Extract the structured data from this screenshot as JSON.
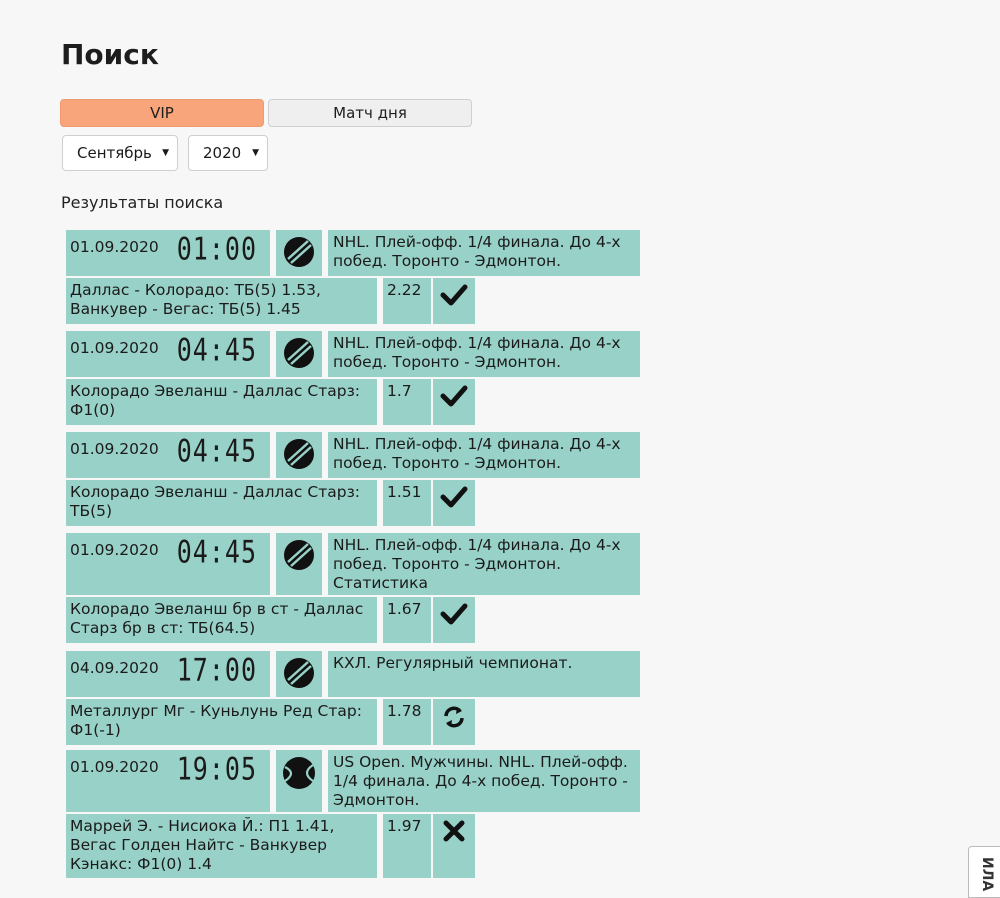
{
  "page": {
    "title": "Поиск"
  },
  "tabs": [
    {
      "label": "VIP",
      "active": true
    },
    {
      "label": "Матч дня",
      "active": false
    }
  ],
  "filters": {
    "month": "Сентябрь",
    "year": "2020"
  },
  "results_title": "Результаты поиска",
  "colors": {
    "row_bg": "#98d1c8",
    "active_tab": "#f8a57c",
    "page_bg": "#f7f7f7"
  },
  "results": [
    {
      "date": "01.09.2020",
      "time": "01:00",
      "sport_icon": "hockey-puck-icon",
      "description": "NHL. Плей-офф. 1/4 финала. До 4-х побед. Торонто - Эдмонтон.",
      "bet": "Даллас - Колорадо: ТБ(5) 1.53, Ванкувер - Вегас: ТБ(5) 1.45",
      "coef": "2.22",
      "status": "win",
      "status_glyph": "✔"
    },
    {
      "date": "01.09.2020",
      "time": "04:45",
      "sport_icon": "hockey-puck-icon",
      "description": "NHL. Плей-офф. 1/4 финала. До 4-х побед. Торонто - Эдмонтон.",
      "bet": "Колорадо Эвеланш - Даллас Старз: Ф1(0)",
      "coef": "1.7",
      "status": "win",
      "status_glyph": "✔"
    },
    {
      "date": "01.09.2020",
      "time": "04:45",
      "sport_icon": "hockey-puck-icon",
      "description": "NHL. Плей-офф. 1/4 финала. До 4-х побед. Торонто - Эдмонтон.",
      "bet": "Колорадо Эвеланш - Даллас Старз: ТБ(5)",
      "coef": "1.51",
      "status": "win",
      "status_glyph": "✔"
    },
    {
      "date": "01.09.2020",
      "time": "04:45",
      "sport_icon": "hockey-puck-icon",
      "description": "NHL. Плей-офф. 1/4 финала. До 4-х побед. Торонто - Эдмонтон. Статистика",
      "bet": "Колорадо Эвеланш бр в ст - Даллас Старз бр в ст: ТБ(64.5)",
      "coef": "1.67",
      "status": "win",
      "status_glyph": "✔"
    },
    {
      "date": "04.09.2020",
      "time": "17:00",
      "sport_icon": "hockey-puck-icon",
      "description": "КХЛ. Регулярный чемпионат.",
      "bet": "Металлург Мг - Куньлунь Ред Стар: Ф1(-1)",
      "coef": "1.78",
      "status": "refund",
      "status_glyph": "⟳"
    },
    {
      "date": "01.09.2020",
      "time": "19:05",
      "sport_icon": "tennis-ball-icon",
      "description": "US Open. Мужчины. NHL. Плей-офф. 1/4 финала. До 4-х побед. Торонто - Эдмонтон.",
      "bet": "Маррей Э. - Нисиока Й.: П1 1.41, Вегас Голден Найтс - Ванкувер Кэнакс: Ф1(0) 1.4",
      "coef": "1.97",
      "status": "loss",
      "status_glyph": "✖"
    }
  ],
  "side_tab": {
    "label": "ИЛА"
  }
}
